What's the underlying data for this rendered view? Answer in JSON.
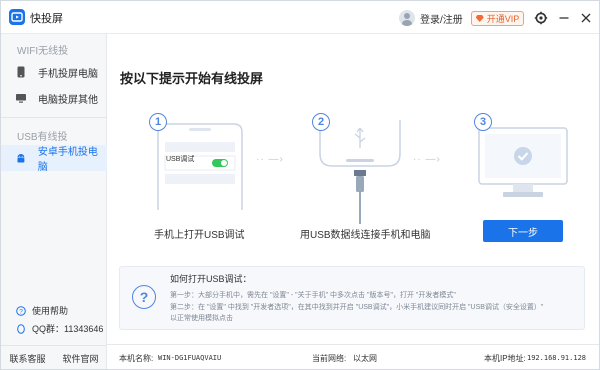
{
  "titlebar": {
    "app_title": "快投屏",
    "login_label": "登录/注册",
    "vip_label": "开通VIP"
  },
  "sidebar": {
    "wifi_section": "WIFI无线投",
    "items": [
      {
        "label": "手机投屏电脑",
        "icon": "phone-icon"
      },
      {
        "label": "电脑投屏其他",
        "icon": "monitor-icon"
      }
    ],
    "usb_section": "USB有线投",
    "usb_items": [
      {
        "label": "安卓手机投电脑",
        "icon": "android-icon"
      }
    ],
    "help_label": "使用帮助",
    "qq_label": "QQ群：11343646",
    "footer": {
      "contact": "联系客服",
      "website": "软件官网"
    }
  },
  "main": {
    "heading": "按以下提示开始有线投屏",
    "steps": [
      {
        "number": "1",
        "label": "手机上打开USB调试",
        "toggle_text": "USB调试"
      },
      {
        "number": "2",
        "label": "用USB数据线连接手机和电脑"
      },
      {
        "number": "3",
        "label": ""
      }
    ],
    "next_button": "下一步",
    "help": {
      "title": "如何打开USB调试：",
      "line1": "第一步：大部分手机中，需先在 \"设置\" - \"关于手机\" 中多次点击 \"版本号\"，打开 \"开发者模式\"",
      "line2": "第二步：在 \"设置\" 中找到 \"开发者选项\"，在其中找到并开启 \"USB调试\"，小米手机建议同时开启 \"USB调试（安全设置）\"",
      "line3": "以正常使用模拟点击"
    }
  },
  "statusbar": {
    "machine_label": "本机名称:",
    "machine_value": "WIN-DG1FUAQVAIU",
    "network_label": "当前网络:",
    "network_value": "以太网",
    "ip_label": "本机IP地址:",
    "ip_value": "192.168.91.128"
  },
  "colors": {
    "accent": "#1a73e8",
    "vip": "#e8612c",
    "toggle_on": "#34c759"
  }
}
